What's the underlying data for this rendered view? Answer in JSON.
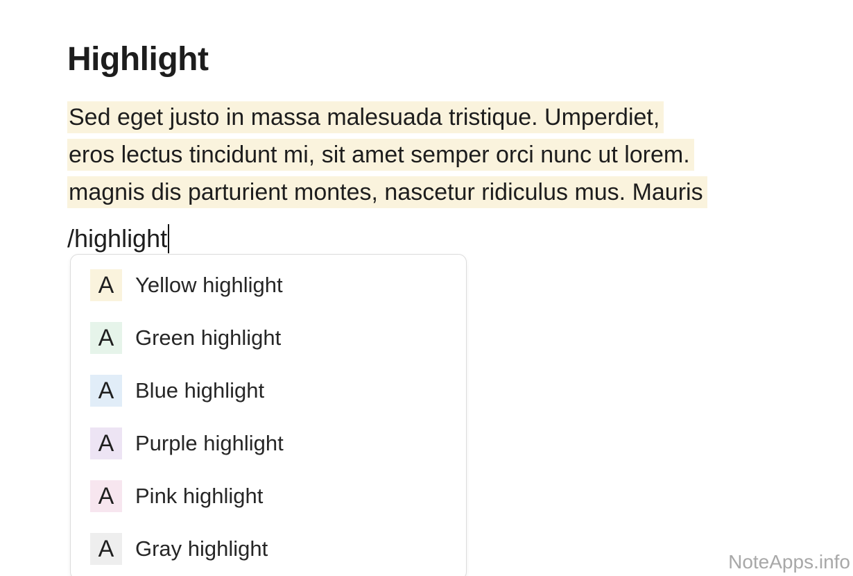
{
  "heading": "Highlight",
  "paragraph": {
    "lines": [
      "Sed eget justo in massa malesuada tristique. Umperdiet,",
      "eros lectus tincidunt mi, sit amet semper orci nunc ut lorem.",
      "magnis dis parturient montes, nascetur ridiculus mus. Mauris"
    ],
    "highlight_color": "#faf3dd"
  },
  "command_input": {
    "value": "/highlight"
  },
  "menu": {
    "items": [
      {
        "icon_letter": "A",
        "label": "Yellow highlight",
        "color": "#faf3dd"
      },
      {
        "icon_letter": "A",
        "label": "Green highlight",
        "color": "#e6f4ea"
      },
      {
        "icon_letter": "A",
        "label": "Blue highlight",
        "color": "#e1edf8"
      },
      {
        "icon_letter": "A",
        "label": "Purple highlight",
        "color": "#ede4f4"
      },
      {
        "icon_letter": "A",
        "label": "Pink highlight",
        "color": "#f7e6ef"
      },
      {
        "icon_letter": "A",
        "label": "Gray highlight",
        "color": "#eeeeee"
      }
    ]
  },
  "watermark": "NoteApps.info"
}
